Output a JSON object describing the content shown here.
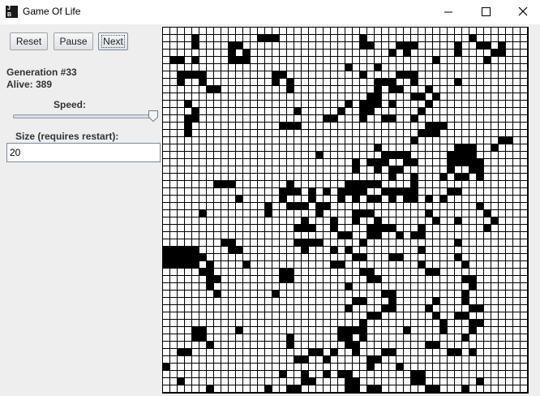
{
  "window": {
    "title": "Game Of Life",
    "icon_text": [
      "J",
      "B"
    ],
    "controls": [
      "minimize-icon",
      "maximize-icon",
      "close-icon"
    ]
  },
  "toolbar": {
    "reset_label": "Reset",
    "pause_label": "Pause",
    "next_label": "Next"
  },
  "stats": {
    "generation": "Generation #33",
    "alive": "Alive: 389"
  },
  "speed": {
    "label": "Speed:",
    "value_fraction": 1.0
  },
  "size": {
    "label": "Size (requires restart):",
    "value": "20"
  },
  "board": {
    "rows": 50,
    "cols": 50,
    "alive_color": "#000000",
    "dead_color": "#ffffff",
    "cells": [
      "...............................................",
      "....#........###...........#..............#.......",
      "....#....##................##...###.....#..##.#...",
      ".........#.#...................#.#......#....##...",
      ".##.#....###.........................#......#.....",
      ".........................#...#...................",
      "..####.........##..........#....###...............",
      "..#..#.........#.#...........###..#.....#.........",
      "......##.........#...........#.##...#..............",
      "............................##....##.#...........",
      "...#.....................#.###.#....#.............",
      "....#.............#.....#..##......#..............",
      "...##.................##...#..##..#...............",
      "...#............###.................###...........",
      "...#...............................###...........",
      "..................................#...........##.",
      ".............................#..........###..#...",
      ".....................#........####.....####......",
      "..........................#.###..##....#####.....",
      "..........................#..#.##......#..##.....",
      "...............................#..#...#.##.#.....",
      ".......###.......#.......#####....#.............",
      "................###.#.#.####..#####....##......",
      "..........#.....#...#...#.#.##.#.##.#.#.........",
      "..............#..###.##....................#....",
      ".....#........#......#....###.......#.......#..",
      "...................#...#..#..#.......#..#....#...",
      "..................###..#....####...#........#....",
      "........................##..##..#.##............",
      "........##........####.....#............#........",
      "#####....##........#...#.#.........#.............",
      "######....................##...##.......#........",
      "#####.#....#...........##..........#.....#.......",
      ".....##.........##.........##.......##..........",
      "......##........##..........##...........##.....",
      "......#..................#................#.....",
      ".......#.......#..............##.........#.......",
      "..........................##...#.....#...#.......",
      ".........................#....##....#.....##.....",
      "............................##.......#..##......",
      "...........................#..........#...##.....",
      "....##....#.............####.....#....#...#.....",
      "....##...........#......##.#.............#......",
      "......#..........#.......##.........##.........",
      "..##................##.#..#...##.......##.#.....",
      "..................##..#.....##.................",
      "#...........................#...#..............",
      "................#..#..#.##........##...........",
      "..#................##....##.......##.......#...",
      "......#.......#..##......##.##......##...#....."
    ]
  }
}
